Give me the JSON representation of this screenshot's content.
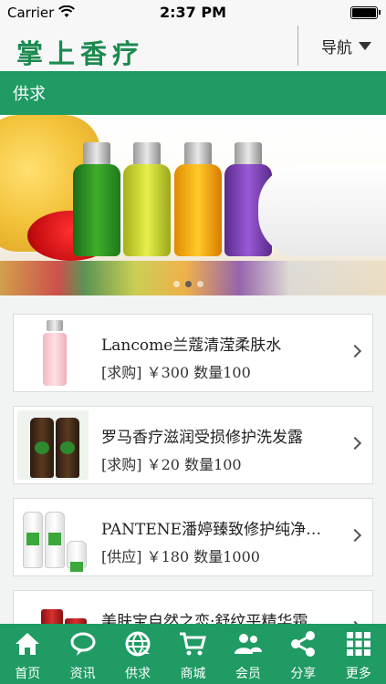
{
  "status_bar": {
    "carrier": "Carrier",
    "time": "2:37 PM"
  },
  "header": {
    "logo": "掌上香疗",
    "nav_label": "导航"
  },
  "section": {
    "title": "供求"
  },
  "banner": {
    "slide_count": 3,
    "active_slide": 1
  },
  "items": [
    {
      "title": "Lancome兰蔻清滢柔肤水",
      "tag": "[求购]",
      "price": "￥300",
      "qty": "数量100",
      "thumb_icon": "toner-bottle-icon"
    },
    {
      "title": "罗马香疗滋润受损修护洗发露",
      "tag": "[求购]",
      "price": "￥20",
      "qty": "数量100",
      "thumb_icon": "shampoo-bottles-icon"
    },
    {
      "title": "PANTENE潘婷臻致修护纯净…",
      "tag": "[供应]",
      "price": "￥180",
      "qty": "数量1000",
      "thumb_icon": "hair-care-set-icon"
    },
    {
      "title": "美肤宝自然之恋·舒纹平精华霜",
      "tag": "",
      "price": "",
      "qty": "",
      "thumb_icon": "serum-bottles-icon"
    }
  ],
  "tabs": [
    {
      "label": "首页",
      "icon": "home-icon"
    },
    {
      "label": "资讯",
      "icon": "chat-bubble-icon"
    },
    {
      "label": "供求",
      "icon": "globe-icon"
    },
    {
      "label": "商城",
      "icon": "cart-icon"
    },
    {
      "label": "会员",
      "icon": "users-icon"
    },
    {
      "label": "分享",
      "icon": "share-icon"
    },
    {
      "label": "更多",
      "icon": "grid-icon"
    }
  ],
  "colors": {
    "brand_green": "#1f9b63",
    "logo_green": "#1c8a50"
  }
}
